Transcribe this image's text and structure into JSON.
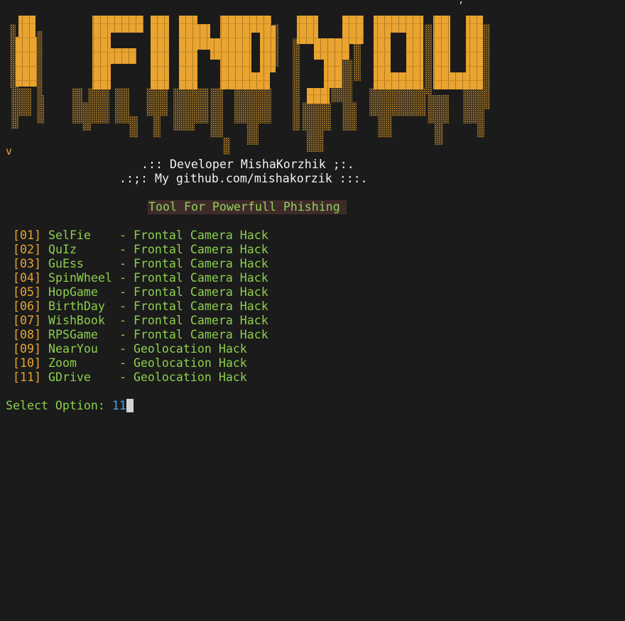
{
  "banner": {
    "text": "I FIND YOU",
    "trail_char": "v",
    "color": "#e9a431"
  },
  "credits": {
    "line1": ".:: Developer MishaKorzhik ;:.",
    "line2": ".:;: My github.com/mishakorzik :::."
  },
  "tagline": "Tool For Powerfull Phishing",
  "menu": [
    {
      "num": "[01]",
      "name": "SelFie",
      "desc": "- Frontal Camera Hack"
    },
    {
      "num": "[02]",
      "name": "QuIz",
      "desc": "- Frontal Camera Hack"
    },
    {
      "num": "[03]",
      "name": "GuEss",
      "desc": "- Frontal Camera Hack"
    },
    {
      "num": "[04]",
      "name": "SpinWheel",
      "desc": "- Frontal Camera Hack"
    },
    {
      "num": "[05]",
      "name": "HopGame",
      "desc": "- Frontal Camera Hack"
    },
    {
      "num": "[06]",
      "name": "BirthDay",
      "desc": "- Frontal Camera Hack"
    },
    {
      "num": "[07]",
      "name": "WishBook",
      "desc": "- Frontal Camera Hack"
    },
    {
      "num": "[08]",
      "name": "RPSGame",
      "desc": "- Frontal Camera Hack"
    },
    {
      "num": "[09]",
      "name": "NearYou",
      "desc": "- Geolocation Hack"
    },
    {
      "num": "[10]",
      "name": "Zoom",
      "desc": "- Geolocation Hack"
    },
    {
      "num": "[11]",
      "name": "GDrive",
      "desc": "- Geolocation Hack"
    }
  ],
  "prompt": {
    "label": "Select Option: ",
    "value": "11"
  },
  "colors": {
    "background": "#1b1b1b",
    "accent": "#e9a431",
    "menu_text": "#8ccf4d",
    "input_value": "#4aa6e6"
  }
}
